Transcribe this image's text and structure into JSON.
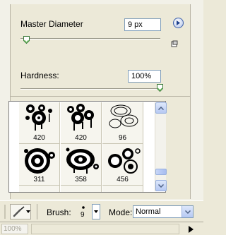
{
  "brush_panel": {
    "master_diameter": {
      "label": "Master Diameter",
      "value": "9 px",
      "slider_fraction": 0.04
    },
    "hardness": {
      "label": "Hardness:",
      "value": "100%",
      "slider_fraction": 1.0
    },
    "presets": [
      {
        "size": "420",
        "icon": "splatter-circles-brush"
      },
      {
        "size": "420",
        "icon": "splatter-circles-drip-brush"
      },
      {
        "size": "96",
        "icon": "outline-circles-brush"
      },
      {
        "size": "311",
        "icon": "target-rings-brush"
      },
      {
        "size": "358",
        "icon": "eye-rings-brush"
      },
      {
        "size": "456",
        "icon": "bubble-rings-brush"
      }
    ]
  },
  "options_bar": {
    "brush_label": "Brush:",
    "brush_size": "9",
    "mode_label": "Mode:",
    "mode_value": "Normal"
  },
  "status_bar": {
    "zoom": "100%"
  }
}
